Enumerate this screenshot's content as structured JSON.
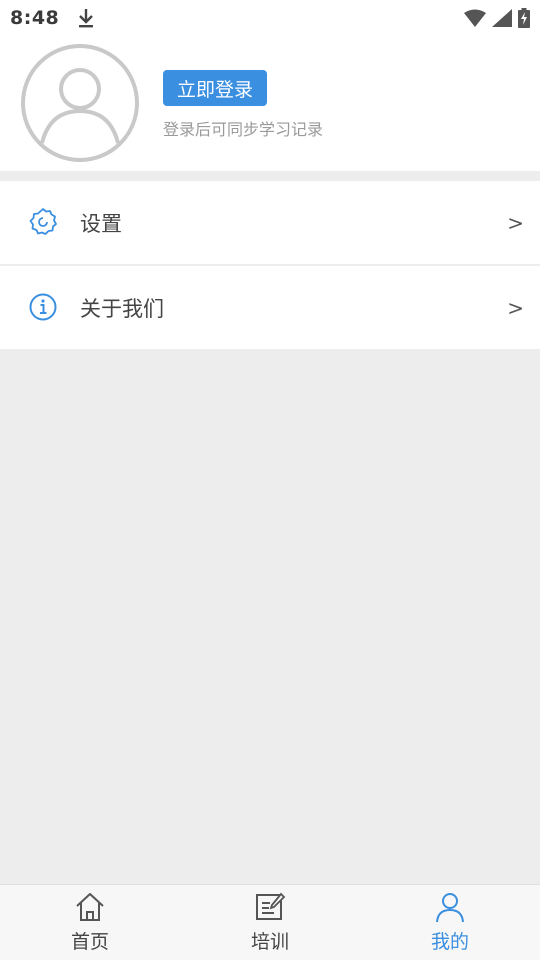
{
  "status_bar": {
    "time": "8:48"
  },
  "profile": {
    "login_label": "立即登录",
    "login_hint": "登录后可同步学习记录"
  },
  "menu": {
    "items": [
      {
        "label": "设置",
        "chevron": ">",
        "icon": "gear-icon"
      },
      {
        "label": "关于我们",
        "chevron": ">",
        "icon": "info-icon"
      }
    ]
  },
  "bottom_nav": {
    "tabs": [
      {
        "label": "首页",
        "icon": "home-icon",
        "active": false
      },
      {
        "label": "培训",
        "icon": "edit-note-icon",
        "active": false
      },
      {
        "label": "我的",
        "icon": "user-icon",
        "active": true
      }
    ]
  },
  "colors": {
    "accent": "#3b8fe0",
    "background": "#ededed",
    "card": "#ffffff"
  }
}
